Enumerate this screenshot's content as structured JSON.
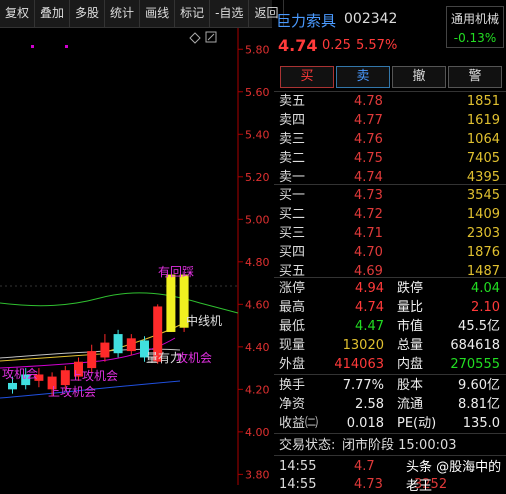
{
  "toolbar": [
    "复权",
    "叠加",
    "多股",
    "统计",
    "画线",
    "标记",
    "-自选",
    "返回"
  ],
  "chart": {
    "price_ticks": [
      "5.80",
      "5.60",
      "5.40",
      "5.20",
      "5.00",
      "4.80",
      "4.60",
      "4.40",
      "4.20",
      "4.00",
      "3.80"
    ],
    "annotations": [
      "有回踩",
      "中线机",
      "量有力",
      "攻机会",
      "上攻机会",
      "上攻机会",
      "攻机会"
    ],
    "chart_data": {
      "type": "candlestick",
      "ylim": [
        3.75,
        5.9
      ],
      "candles": [
        {
          "o": 4.23,
          "c": 4.2,
          "h": 4.26,
          "l": 4.18
        },
        {
          "o": 4.27,
          "c": 4.22,
          "h": 4.3,
          "l": 4.2
        },
        {
          "o": 4.24,
          "c": 4.27,
          "h": 4.3,
          "l": 4.21
        },
        {
          "o": 4.2,
          "c": 4.26,
          "h": 4.28,
          "l": 4.17
        },
        {
          "o": 4.22,
          "c": 4.29,
          "h": 4.31,
          "l": 4.2
        },
        {
          "o": 4.26,
          "c": 4.33,
          "h": 4.35,
          "l": 4.24
        },
        {
          "o": 4.3,
          "c": 4.38,
          "h": 4.41,
          "l": 4.28
        },
        {
          "o": 4.35,
          "c": 4.42,
          "h": 4.46,
          "l": 4.33
        },
        {
          "o": 4.46,
          "c": 4.37,
          "h": 4.48,
          "l": 4.35
        },
        {
          "o": 4.38,
          "c": 4.44,
          "h": 4.46,
          "l": 4.36
        },
        {
          "o": 4.43,
          "c": 4.35,
          "h": 4.45,
          "l": 4.33
        },
        {
          "o": 4.33,
          "c": 4.59,
          "h": 4.6,
          "l": 4.32
        },
        {
          "o": 4.74,
          "c": 4.47,
          "h": 4.74,
          "l": 4.47
        },
        {
          "o": 4.49,
          "c": 4.74,
          "h": 4.74,
          "l": 4.47
        }
      ]
    }
  },
  "stock": {
    "name": "巨力索具",
    "code": "002342",
    "price": "4.74",
    "change": "0.25",
    "pct": "5.57%",
    "industry": "通用机械",
    "industry_pct": "-0.13%"
  },
  "actions": [
    "买",
    "卖",
    "撤",
    "警"
  ],
  "asks": [
    {
      "label": "卖五",
      "price": "4.78",
      "vol": "1851"
    },
    {
      "label": "卖四",
      "price": "4.77",
      "vol": "1619"
    },
    {
      "label": "卖三",
      "price": "4.76",
      "vol": "1064"
    },
    {
      "label": "卖二",
      "price": "4.75",
      "vol": "7405"
    },
    {
      "label": "卖一",
      "price": "4.74",
      "vol": "4395"
    }
  ],
  "bids": [
    {
      "label": "买一",
      "price": "4.73",
      "vol": "3545"
    },
    {
      "label": "买二",
      "price": "4.72",
      "vol": "1409"
    },
    {
      "label": "买三",
      "price": "4.71",
      "vol": "2303"
    },
    {
      "label": "买四",
      "price": "4.70",
      "vol": "1876"
    },
    {
      "label": "买五",
      "price": "4.69",
      "vol": "1487"
    }
  ],
  "stats": [
    {
      "l1": "涨停",
      "v1": "4.94",
      "c1": "red",
      "l2": "跌停",
      "v2": "4.04",
      "c2": "green"
    },
    {
      "l1": "最高",
      "v1": "4.74",
      "c1": "red",
      "l2": "量比",
      "v2": "2.10",
      "c2": "red"
    },
    {
      "l1": "最低",
      "v1": "4.47",
      "c1": "green",
      "l2": "市值",
      "v2": "45.5亿",
      "c2": "white"
    },
    {
      "l1": "现量",
      "v1": "13020",
      "c1": "yellow",
      "l2": "总量",
      "v2": "684618",
      "c2": "white"
    },
    {
      "l1": "外盘",
      "v1": "414063",
      "c1": "red",
      "l2": "内盘",
      "v2": "270555",
      "c2": "green"
    }
  ],
  "stats2": [
    {
      "l1": "换手",
      "v1": "7.77%",
      "l2": "股本",
      "v2": "9.60亿"
    },
    {
      "l1": "净资",
      "v1": "2.58",
      "l2": "流通",
      "v2": "8.81亿"
    },
    {
      "l1": "收益㈡",
      "v1": "0.018",
      "l2": "PE(动)",
      "v2": "135.0"
    }
  ],
  "status": {
    "label": "交易状态:",
    "value": "闭市阶段 15:00:03"
  },
  "ticks": [
    {
      "time": "14:55",
      "price": "4.7"
    },
    {
      "time": "14:55",
      "price": "4.73",
      "vol": "3252"
    }
  ],
  "watermark": "头条 @股海中的老王"
}
